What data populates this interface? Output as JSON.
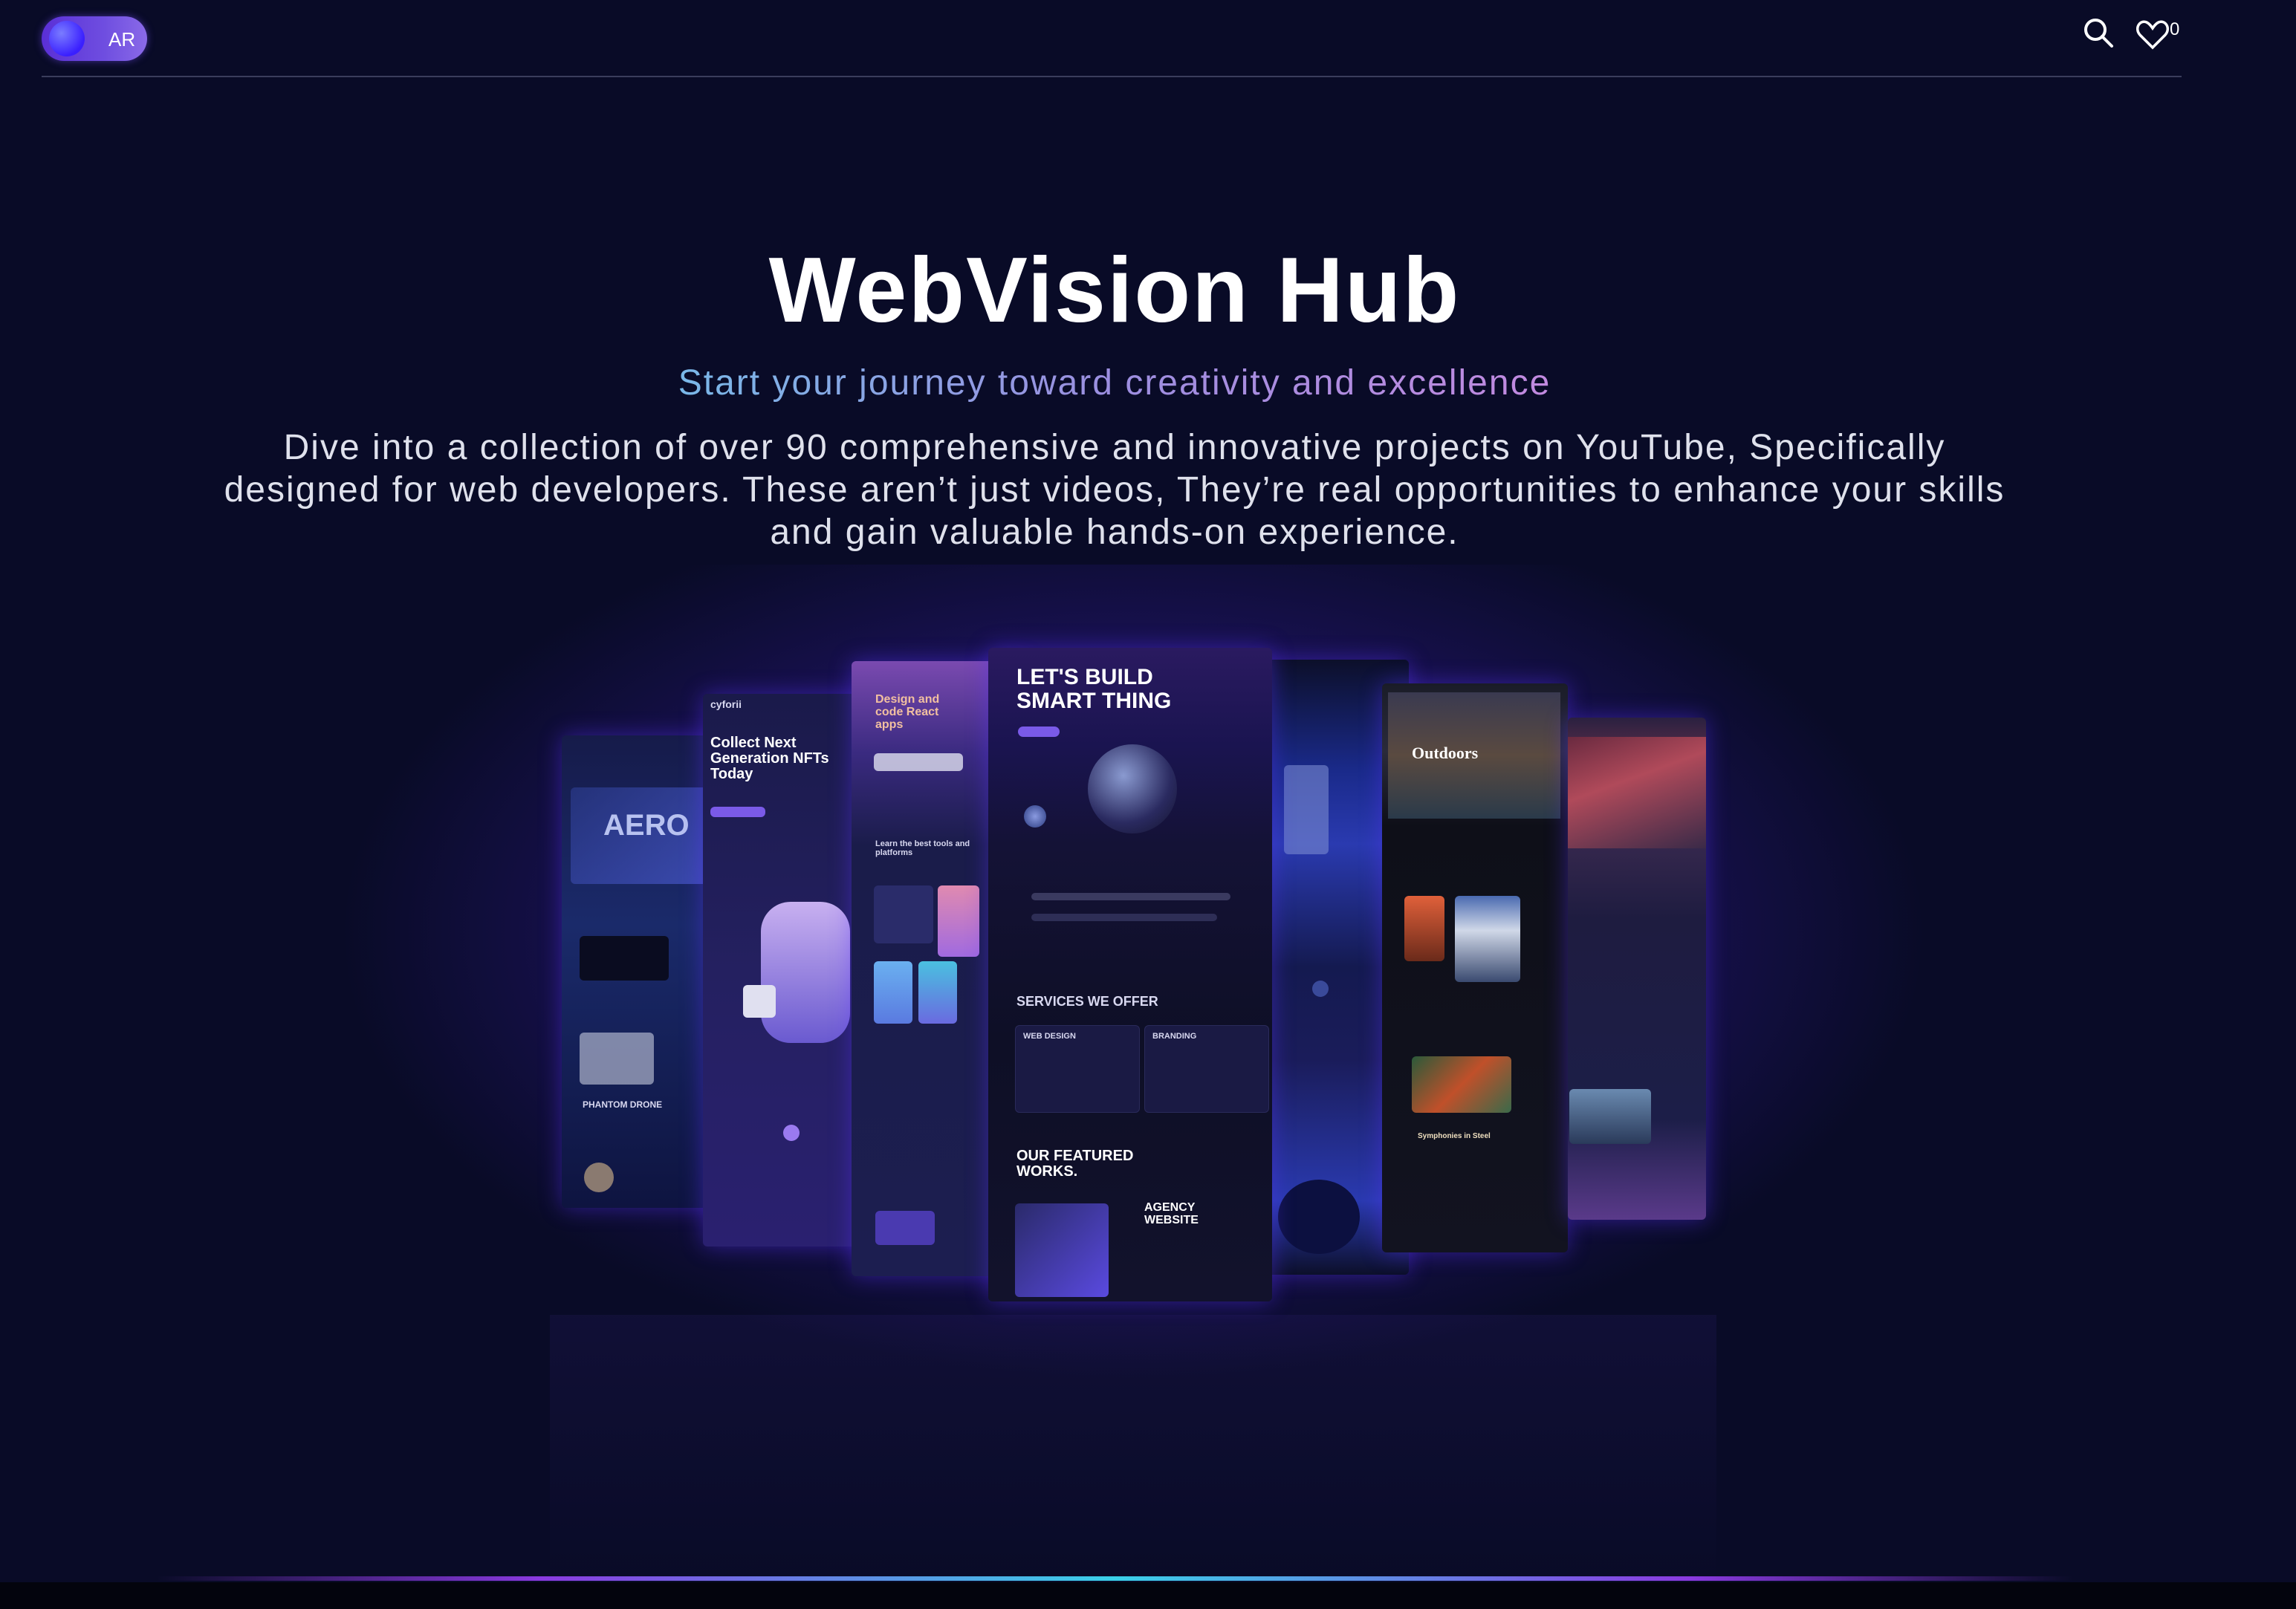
{
  "header": {
    "language_toggle": "AR",
    "favorites_count": "0",
    "icons": [
      "search-icon",
      "heart-icon"
    ]
  },
  "hero": {
    "title": "WebVision Hub",
    "subtitle": "Start your journey toward creativity and excellence",
    "description": "Dive into a collection of over 90 comprehensive and innovative projects on YouTube, Specifically designed for web developers. These aren’t just videos, They’re real opportunities to enhance your skills and gain valuable hands-on experience."
  },
  "showcase": {
    "cards": [
      {
        "name": "aero-drone",
        "headline": "AERO",
        "extra": "PHANTOM DRONE"
      },
      {
        "name": "nft-site",
        "headline": "Collect Next Generation NFTs Today",
        "extra": "cyforii"
      },
      {
        "name": "design-code",
        "headline": "Design and code React apps",
        "extra": "Learn the best tools and platforms"
      },
      {
        "name": "agency",
        "headline": "LET'S BUILD SMART THING",
        "extra": "SERVICES WE OFFER",
        "extra2": "OUR FEATURED WORKS.",
        "extra3": "AGENCY WEBSITE",
        "extra4": "WEB DESIGN",
        "extra5": "BRANDING"
      },
      {
        "name": "night-sky",
        "headline": "",
        "extra": ""
      },
      {
        "name": "outdoors",
        "headline": "Outdoors",
        "extra": "Symphonies in Steel"
      },
      {
        "name": "mountains",
        "headline": "",
        "extra": ""
      }
    ]
  },
  "colors": {
    "background": "#090b27",
    "accent": "#6f4ee0",
    "glow": "#643cff"
  }
}
